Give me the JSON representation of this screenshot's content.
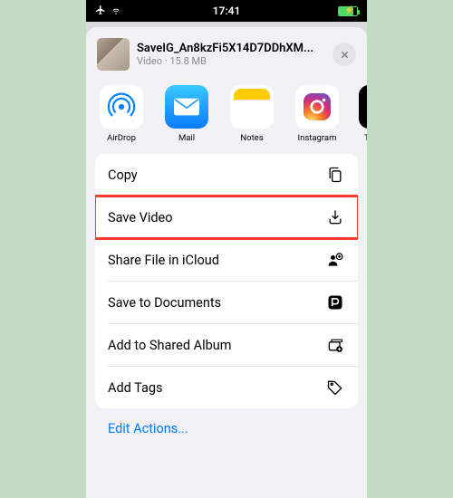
{
  "status": {
    "time": "17:41"
  },
  "file": {
    "name": "SaveIG_An8kzFi5X14D7DDhXM...",
    "kind": "Video",
    "size": "15.8 MB"
  },
  "apps": [
    {
      "id": "airdrop",
      "label": "AirDrop"
    },
    {
      "id": "mail",
      "label": "Mail"
    },
    {
      "id": "notes",
      "label": "Notes"
    },
    {
      "id": "instagram",
      "label": "Instagram"
    },
    {
      "id": "next",
      "label": "T"
    }
  ],
  "actions": [
    {
      "id": "copy",
      "label": "Copy",
      "icon": "copy-icon",
      "highlight": false
    },
    {
      "id": "save-video",
      "label": "Save Video",
      "icon": "download-icon",
      "highlight": true
    },
    {
      "id": "share-icloud",
      "label": "Share File in iCloud",
      "icon": "person-cloud-icon",
      "highlight": false
    },
    {
      "id": "save-documents",
      "label": "Save to Documents",
      "icon": "documents-app-icon",
      "highlight": false
    },
    {
      "id": "add-shared-album",
      "label": "Add to Shared Album",
      "icon": "shared-album-icon",
      "highlight": false
    },
    {
      "id": "add-tags",
      "label": "Add Tags",
      "icon": "tag-icon",
      "highlight": false
    }
  ],
  "edit": {
    "label": "Edit Actions..."
  }
}
